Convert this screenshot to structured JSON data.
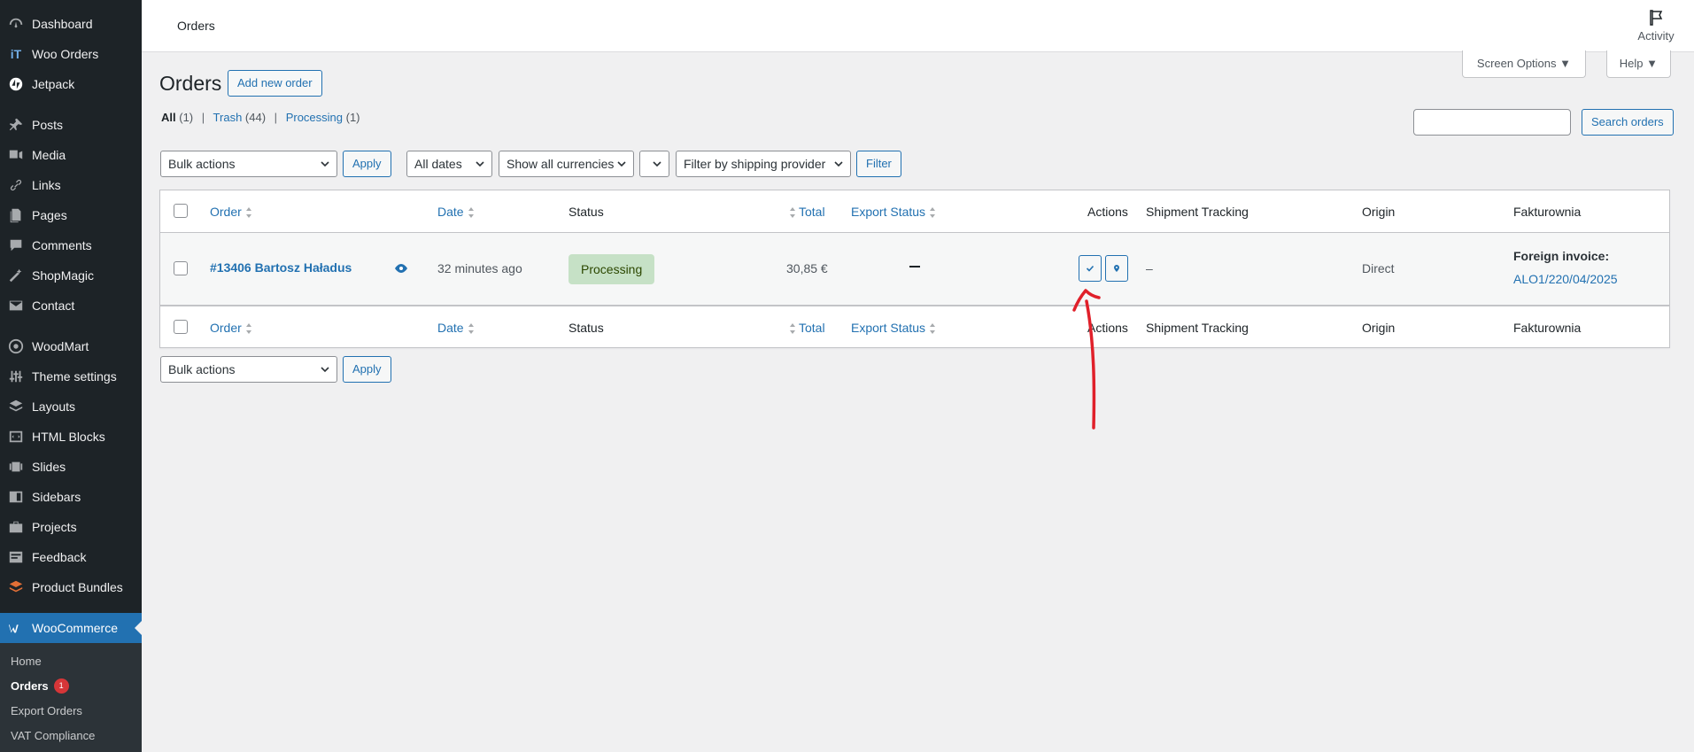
{
  "sidebar": {
    "items": [
      {
        "label": "Dashboard",
        "icon": "dashboard-icon"
      },
      {
        "label": "Woo Orders",
        "icon": "it-logo-icon"
      },
      {
        "label": "Jetpack",
        "icon": "jetpack-icon"
      },
      {
        "label": "Posts",
        "icon": "pin-icon"
      },
      {
        "label": "Media",
        "icon": "media-icon"
      },
      {
        "label": "Links",
        "icon": "link-icon"
      },
      {
        "label": "Pages",
        "icon": "pages-icon"
      },
      {
        "label": "Comments",
        "icon": "comment-icon"
      },
      {
        "label": "ShopMagic",
        "icon": "magic-wand-icon"
      },
      {
        "label": "Contact",
        "icon": "mail-icon"
      },
      {
        "label": "WoodMart",
        "icon": "woodmart-icon"
      },
      {
        "label": "Theme settings",
        "icon": "sliders-icon"
      },
      {
        "label": "Layouts",
        "icon": "layers-icon"
      },
      {
        "label": "HTML Blocks",
        "icon": "code-block-icon"
      },
      {
        "label": "Slides",
        "icon": "slides-icon"
      },
      {
        "label": "Sidebars",
        "icon": "sidebar-icon"
      },
      {
        "label": "Projects",
        "icon": "briefcase-icon"
      },
      {
        "label": "Feedback",
        "icon": "feedback-icon"
      },
      {
        "label": "Product Bundles",
        "icon": "bundles-icon"
      },
      {
        "label": "WooCommerce",
        "icon": "woocommerce-icon"
      }
    ],
    "submenu": [
      {
        "label": "Home"
      },
      {
        "label": "Orders",
        "badge": "1"
      },
      {
        "label": "Export Orders"
      },
      {
        "label": "VAT Compliance"
      }
    ]
  },
  "topbar": {
    "title": "Orders",
    "activity_label": "Activity",
    "screen_options_label": "Screen Options ▼",
    "help_label": "Help ▼"
  },
  "main": {
    "heading": "Orders",
    "add_new_label": "Add new order",
    "views": {
      "all_label": "All",
      "all_count": "(1)",
      "trash_label": "Trash",
      "trash_count": "(44)",
      "processing_label": "Processing",
      "processing_count": "(1)"
    },
    "search_button_label": "Search orders",
    "filters": {
      "bulk_actions": "Bulk actions",
      "apply_label": "Apply",
      "dates": "All dates",
      "currencies": "Show all currencies",
      "shipping_provider": "Filter by shipping provider",
      "filter_label": "Filter"
    }
  },
  "table": {
    "columns": {
      "order": "Order",
      "date": "Date",
      "status": "Status",
      "total": "Total",
      "export_status": "Export Status",
      "actions": "Actions",
      "shipment_tracking": "Shipment Tracking",
      "origin": "Origin",
      "fakturownia": "Fakturownia"
    },
    "rows": [
      {
        "order": "#13406 Bartosz Haładus",
        "date": "32 minutes ago",
        "status": "Processing",
        "total": "30,85 €",
        "shipment_tracking": "–",
        "origin": "Direct",
        "invoice_label": "Foreign invoice:",
        "invoice_number": "ALO1/220/04/2025"
      }
    ]
  },
  "colors": {
    "accent": "#2271b1",
    "sidebar_bg": "#1d2327",
    "status_processing_bg": "#c6e1c6",
    "annotation": "#e0202a"
  }
}
